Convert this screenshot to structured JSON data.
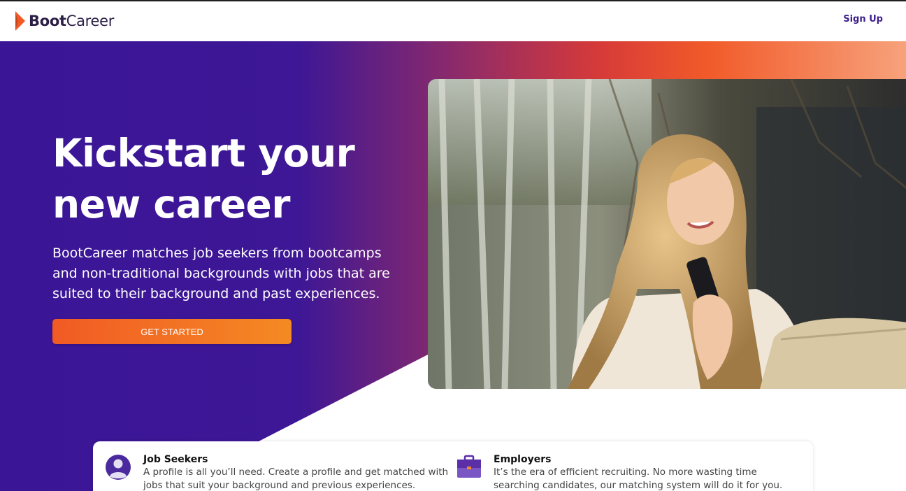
{
  "nav": {
    "logo_bold": "Boot",
    "logo_regular": "Career",
    "signup_label": "Sign Up"
  },
  "hero": {
    "headline_line1": "Kickstart your",
    "headline_line2": "new career",
    "subtext": "BootCareer matches job seekers from bootcamps and non-traditional backgrounds with jobs that are suited to their background and past experiences.",
    "cta_label": "GET STARTED",
    "photo_icon": "woman-on-phone-photo"
  },
  "cards": {
    "seekers": {
      "icon": "user-avatar-icon",
      "title": "Job Seekers",
      "text": "A profile is all you’ll need. Create a profile and get matched with jobs that suit your background and previous experiences."
    },
    "employers": {
      "icon": "briefcase-icon",
      "title": "Employers",
      "text": "It’s the era of efficient recruiting. No more wasting time searching candidates, our matching system will do it for you."
    }
  },
  "colors": {
    "primary_purple": "#3d1795",
    "accent_orange": "#f15a24",
    "nav_link": "#3d1f8c"
  }
}
